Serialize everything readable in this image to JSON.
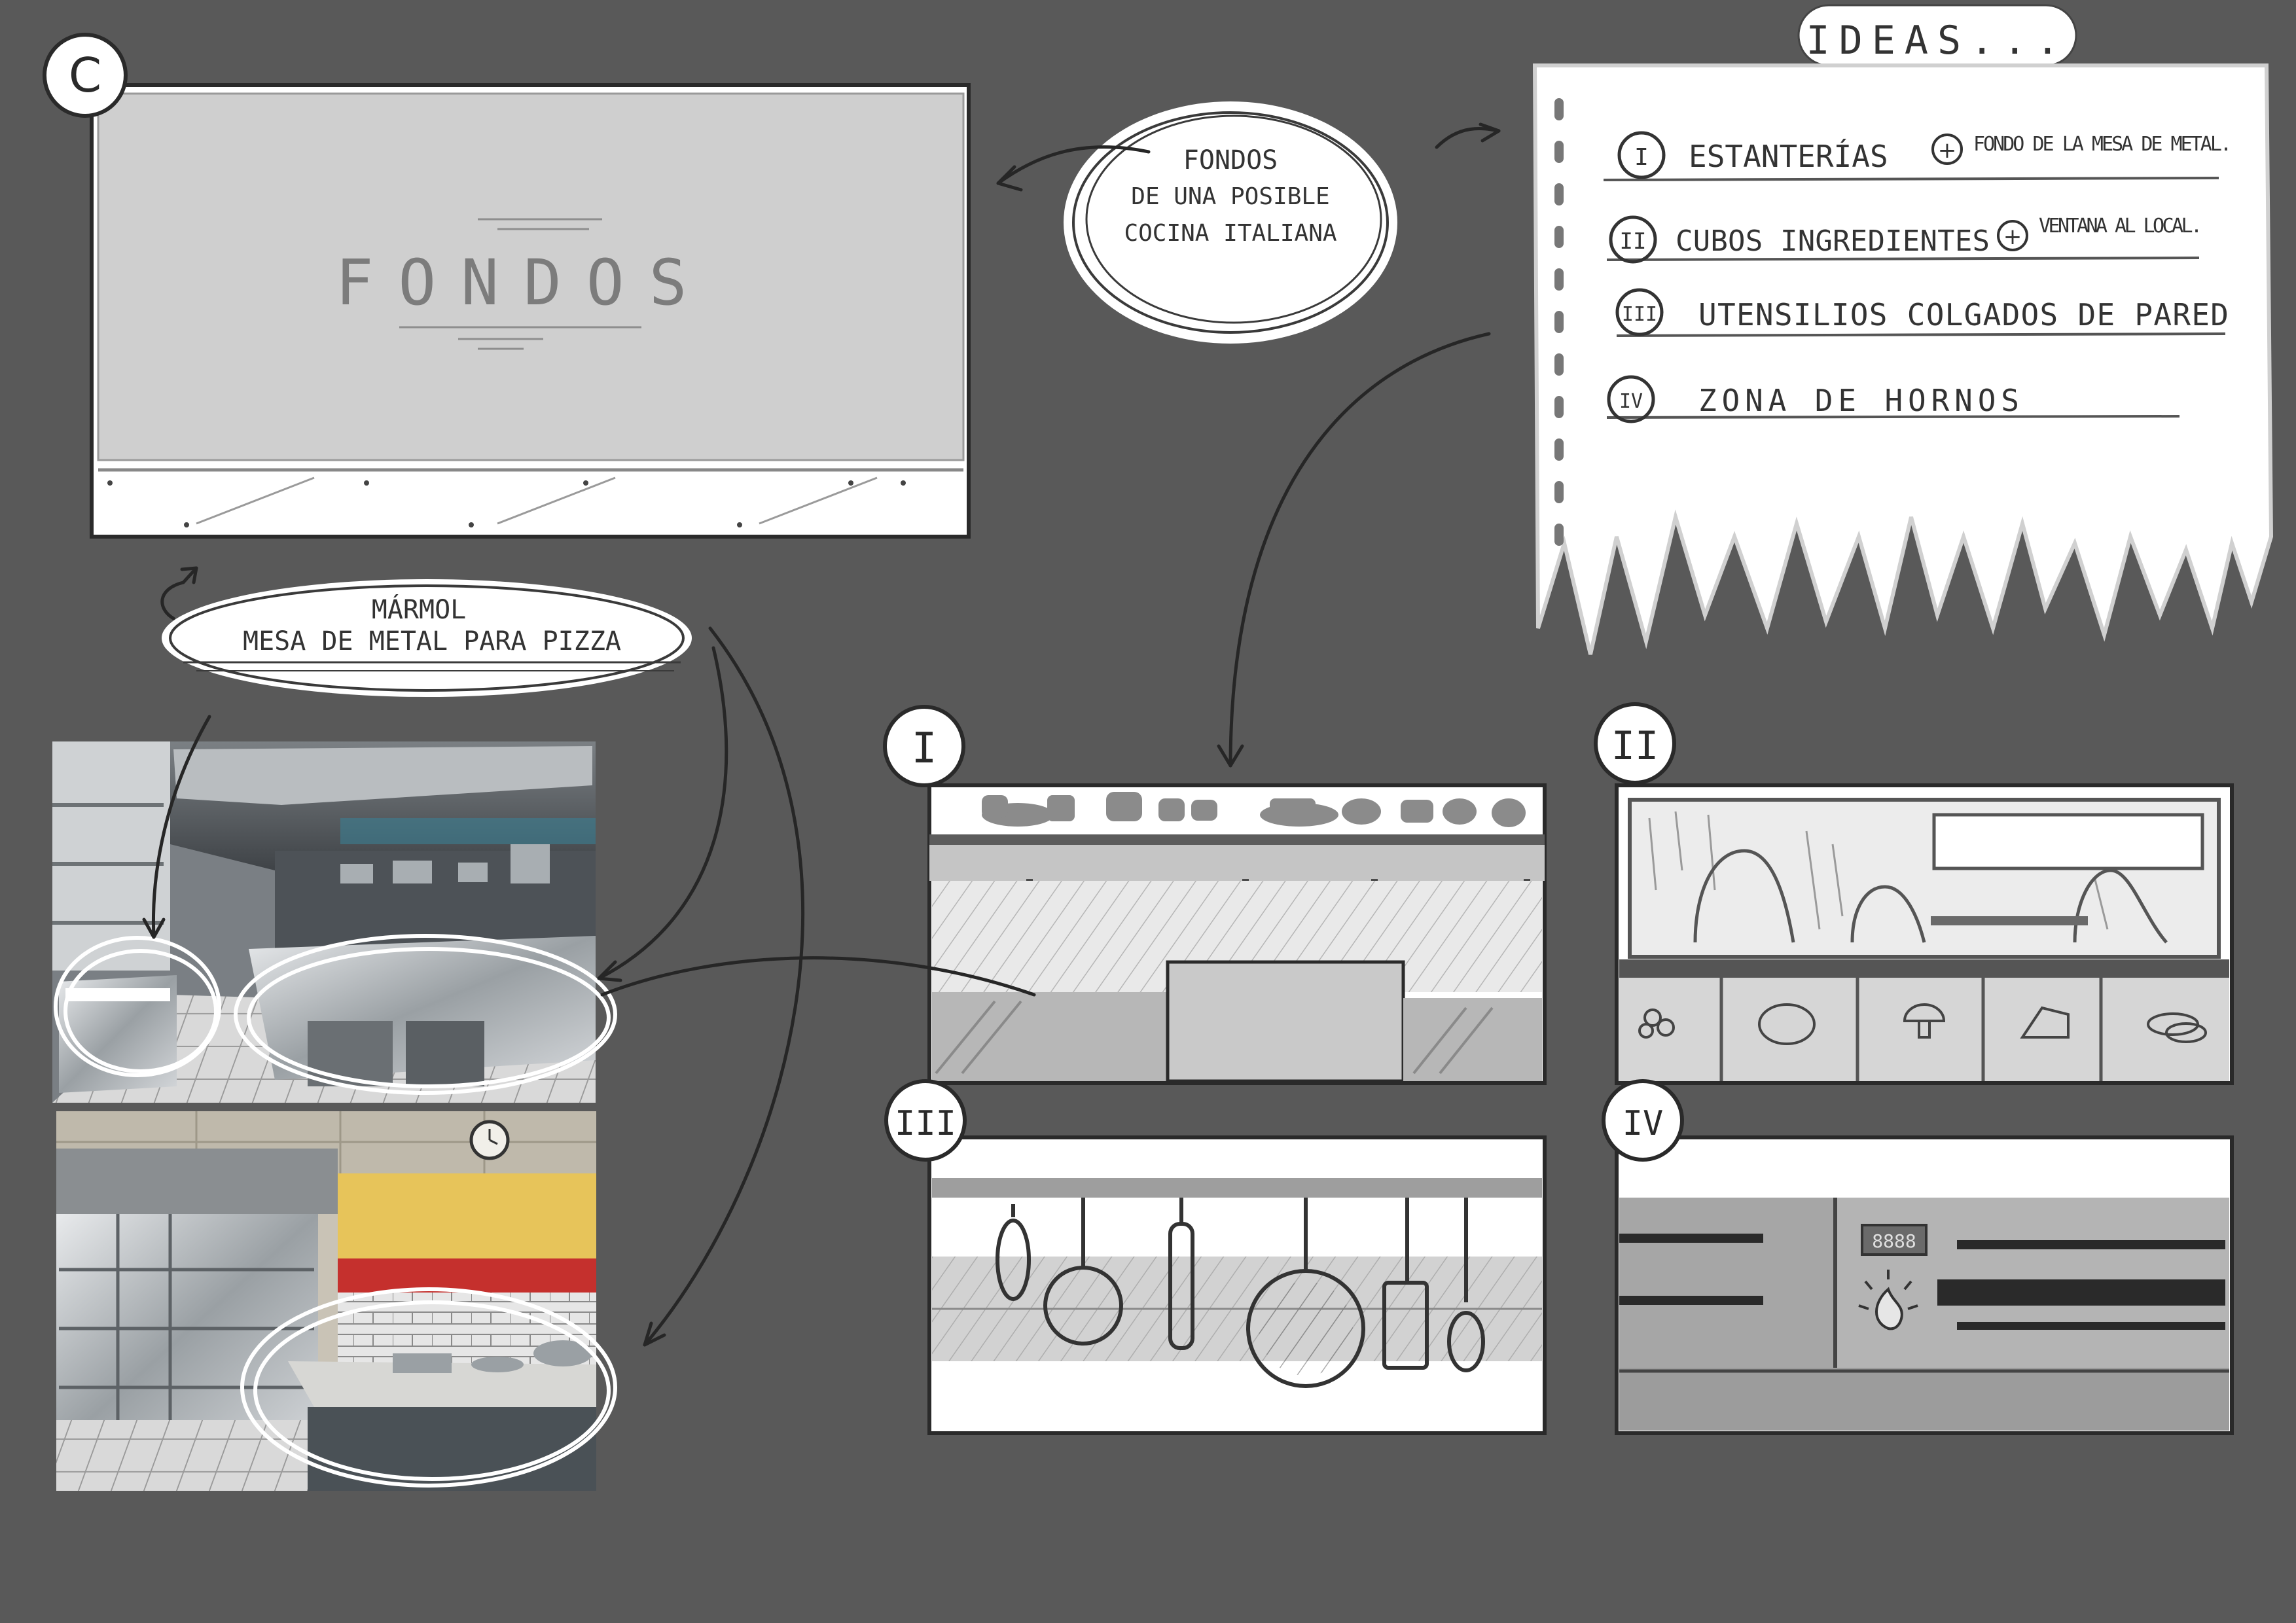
{
  "sheet_badge": "C",
  "main_panel": {
    "label": "FONDOS"
  },
  "note_backgrounds": {
    "line1": "FONDOS",
    "line2": "DE UNA POSIBLE",
    "line3": "COCINA ITALIANA"
  },
  "note_marble": {
    "line1": "MÁRMOL",
    "line2": "MESA DE METAL PARA PIZZA"
  },
  "ideas": {
    "title": "IDEAS...",
    "items": [
      {
        "num": "I",
        "text": "ESTANTERÍAS",
        "extra": "FONDO DE LA MESA DE METAL."
      },
      {
        "num": "II",
        "text": "CUBOS INGREDIENTES",
        "extra": "VENTANA AL LOCAL."
      },
      {
        "num": "III",
        "text": "UTENSILIOS COLGADOS DE PARED",
        "extra": ""
      },
      {
        "num": "IV",
        "text": "ZONA DE HORNOS",
        "extra": ""
      }
    ]
  },
  "panels": [
    {
      "num": "I"
    },
    {
      "num": "II"
    },
    {
      "num": "III"
    },
    {
      "num": "IV"
    }
  ],
  "oven_display": "8888",
  "colors": {
    "background": "#595959",
    "paper": "#ffffff",
    "ink": "#3a3a3a",
    "sketch_gray": "#cfcfcf"
  }
}
